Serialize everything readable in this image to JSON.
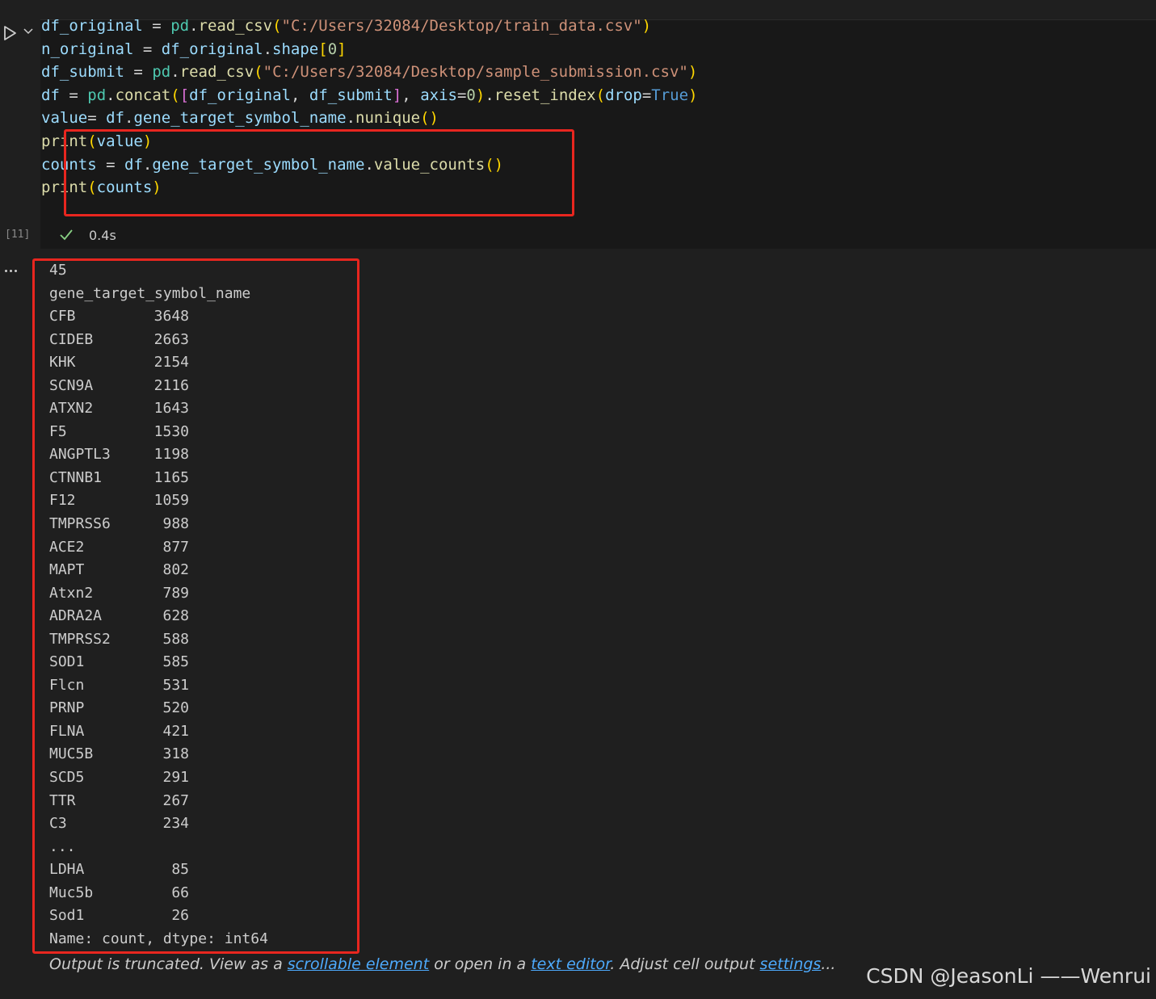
{
  "cell": {
    "execution_count": "[11]",
    "duration": "0.4s",
    "code_lines": [
      "df_original = pd.read_csv(\"C:/Users/32084/Desktop/train_data.csv\")",
      "n_original = df_original.shape[0]",
      "df_submit = pd.read_csv(\"C:/Users/32084/Desktop/sample_submission.csv\")",
      "df = pd.concat([df_original, df_submit], axis=0).reset_index(drop=True)",
      "value= df.gene_target_symbol_name.nunique()",
      "print(value)",
      "counts = df.gene_target_symbol_name.value_counts()",
      "print(counts)"
    ]
  },
  "output": {
    "nunique": "45",
    "header": "gene_target_symbol_name",
    "rows": [
      {
        "name": "CFB",
        "count": "3648"
      },
      {
        "name": "CIDEB",
        "count": "2663"
      },
      {
        "name": "KHK",
        "count": "2154"
      },
      {
        "name": "SCN9A",
        "count": "2116"
      },
      {
        "name": "ATXN2",
        "count": "1643"
      },
      {
        "name": "F5",
        "count": "1530"
      },
      {
        "name": "ANGPTL3",
        "count": "1198"
      },
      {
        "name": "CTNNB1",
        "count": "1165"
      },
      {
        "name": "F12",
        "count": "1059"
      },
      {
        "name": "TMPRSS6",
        "count": "988"
      },
      {
        "name": "ACE2",
        "count": "877"
      },
      {
        "name": "MAPT",
        "count": "802"
      },
      {
        "name": "Atxn2",
        "count": "789"
      },
      {
        "name": "ADRA2A",
        "count": "628"
      },
      {
        "name": "TMPRSS2",
        "count": "588"
      },
      {
        "name": "SOD1",
        "count": "585"
      },
      {
        "name": "Flcn",
        "count": "531"
      },
      {
        "name": "PRNP",
        "count": "520"
      },
      {
        "name": "FLNA",
        "count": "421"
      },
      {
        "name": "MUC5B",
        "count": "318"
      },
      {
        "name": "SCD5",
        "count": "291"
      },
      {
        "name": "TTR",
        "count": "267"
      },
      {
        "name": "C3",
        "count": "234"
      }
    ],
    "ellipsis": "...",
    "tail_rows": [
      {
        "name": "LDHA",
        "count": "85"
      },
      {
        "name": "Muc5b",
        "count": "66"
      },
      {
        "name": "Sod1",
        "count": "26"
      }
    ],
    "footer": "Name: count, dtype: int64"
  },
  "truncation": {
    "text1": "Output is truncated. View as a ",
    "link1": "scrollable element",
    "text2": " or open in a ",
    "link2": "text editor",
    "text3": ". Adjust cell output ",
    "link3": "settings",
    "text4": "..."
  },
  "watermark": "CSDN @JeasonLi ——Wenrui",
  "colors": {
    "highlight_border": "#e8261f",
    "link": "#4daafc",
    "check": "#89d185"
  }
}
